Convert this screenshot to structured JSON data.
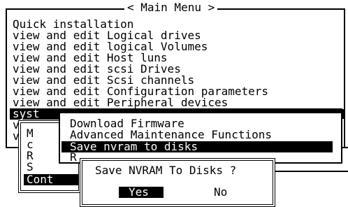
{
  "main_menu": {
    "title": "< Main Menu >",
    "items": [
      "Quick installation",
      "view and edit Logical drives",
      "view and edit logical Volumes",
      "view and edit Host luns",
      "view and edit scsi Drives",
      "view and edit Scsi channels",
      "view and edit Configuration parameters",
      "view and edit Peripheral devices"
    ],
    "selected_item": "syst",
    "item_fragments": [
      "v",
      "v"
    ]
  },
  "system_functions_fragments": [
    "M",
    "c",
    "R",
    "S"
  ],
  "system_functions_selected": "Cont",
  "submenu": {
    "items": [
      "Download Firmware",
      "Advanced Maintenance Functions",
      "Save nvram to disks"
    ],
    "selected_index": 2,
    "partial_item": "R"
  },
  "dialog": {
    "title": "Save NVRAM To Disks ?",
    "yes_label": "Yes",
    "no_label": "No"
  }
}
